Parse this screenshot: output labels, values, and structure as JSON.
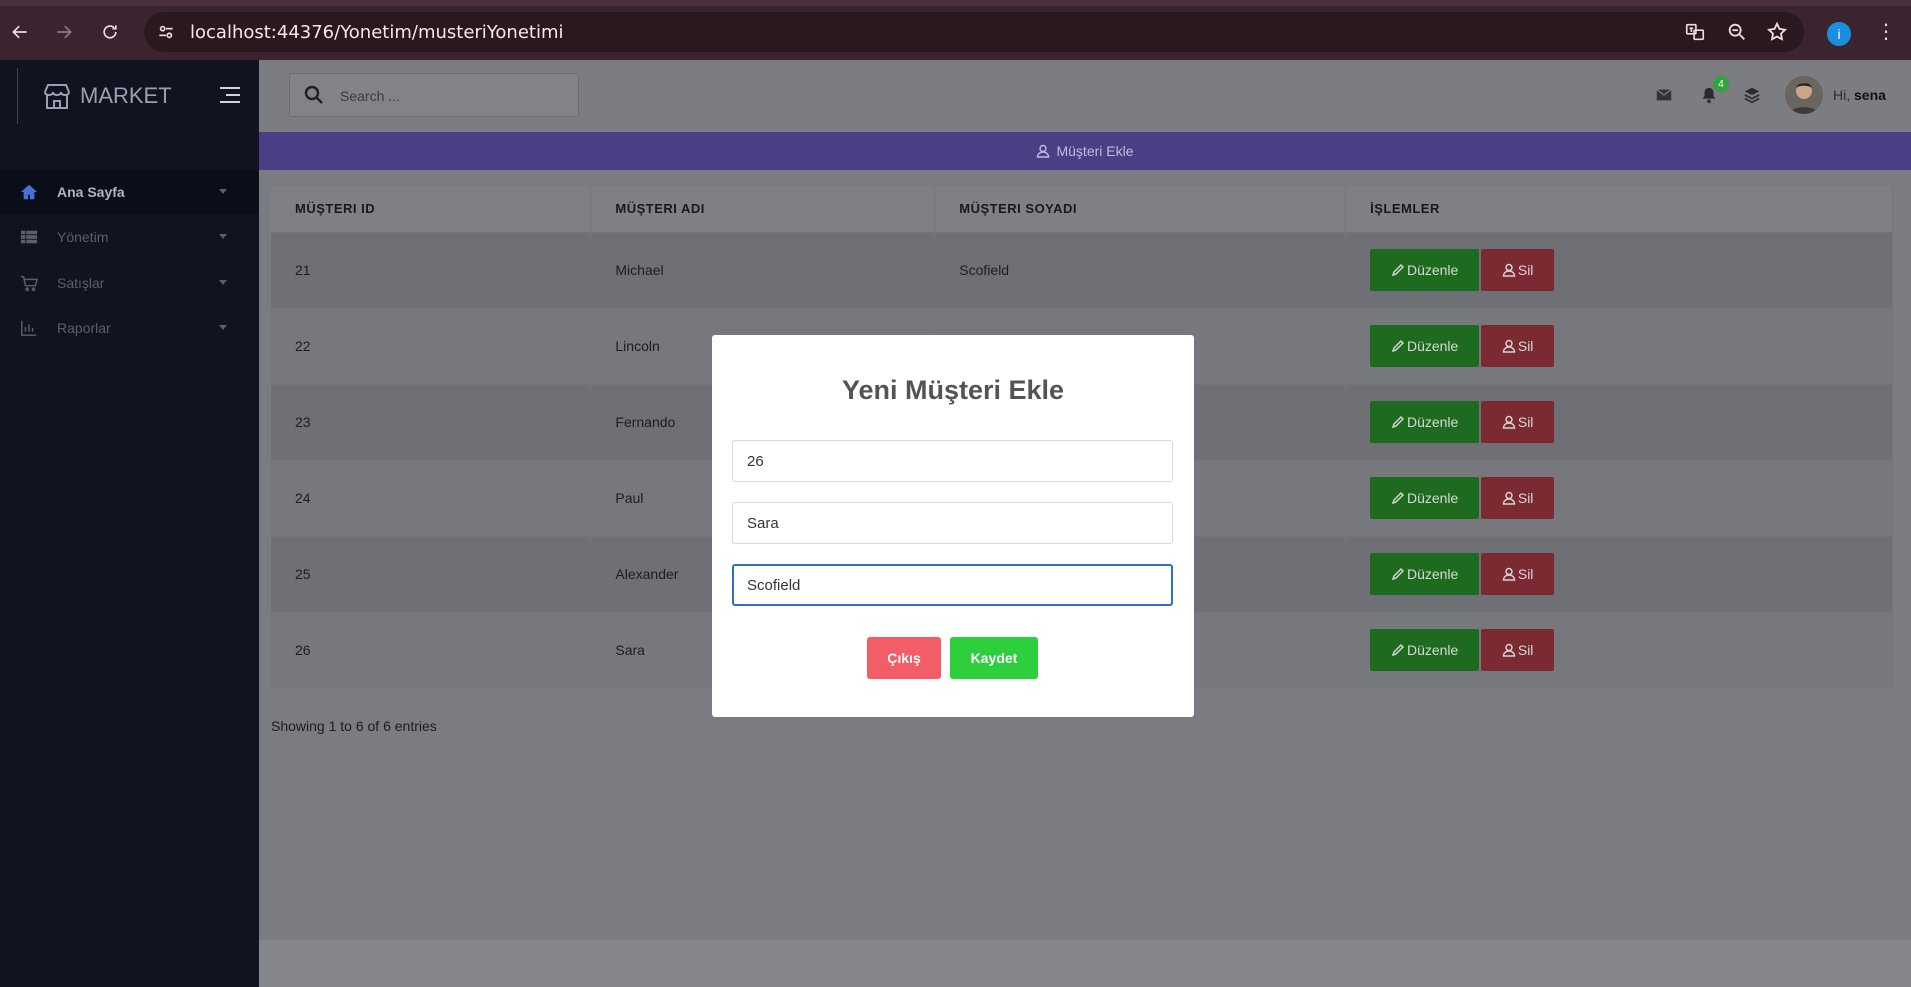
{
  "browser": {
    "url": "localhost:44376/Yonetim/musteriYonetimi",
    "profile_initial": "i"
  },
  "sidebar": {
    "brand": "MARKET",
    "items": [
      {
        "label": "Ana Sayfa",
        "icon": "home-icon",
        "active": true
      },
      {
        "label": "Yönetim",
        "icon": "table-icon",
        "active": false
      },
      {
        "label": "Satışlar",
        "icon": "cart-icon",
        "active": false
      },
      {
        "label": "Raporlar",
        "icon": "bar-chart-icon",
        "active": false
      }
    ]
  },
  "header": {
    "search_placeholder": "Search ...",
    "notification_count": "4",
    "greeting": "Hi,",
    "username": "sena"
  },
  "add_bar": {
    "label": "Müşteri Ekle"
  },
  "table": {
    "columns": [
      "MÜŞTERI ID",
      "MÜŞTERI ADI",
      "MÜŞTERI SOYADI",
      "İŞLEMLER"
    ],
    "rows": [
      {
        "id": "21",
        "name": "Michael",
        "surname": "Scofield"
      },
      {
        "id": "22",
        "name": "Lincoln",
        "surname": ""
      },
      {
        "id": "23",
        "name": "Fernando",
        "surname": ""
      },
      {
        "id": "24",
        "name": "Paul",
        "surname": ""
      },
      {
        "id": "25",
        "name": "Alexander",
        "surname": ""
      },
      {
        "id": "26",
        "name": "Sara",
        "surname": ""
      }
    ],
    "edit_label": "Düzenle",
    "delete_label": "Sil",
    "entries_text": "Showing 1 to 6 of 6 entries"
  },
  "modal": {
    "title": "Yeni Müşteri Ekle",
    "id_value": "26",
    "name_value": "Sara",
    "surname_value": "Scofield",
    "cancel_label": "Çıkış",
    "save_label": "Kaydet"
  }
}
